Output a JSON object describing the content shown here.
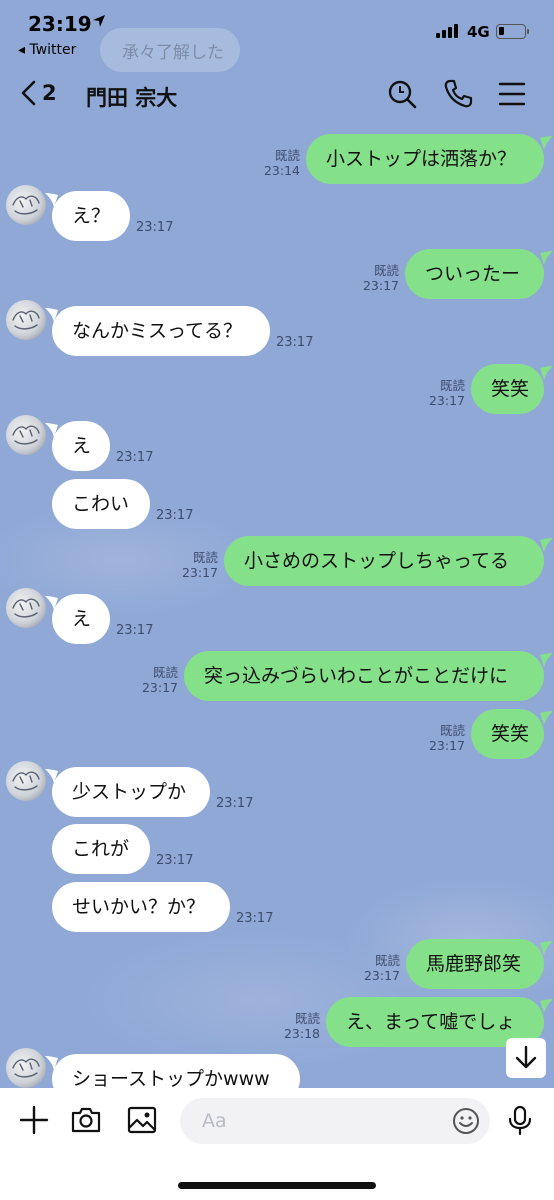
{
  "status_bar": {
    "time": "23:19",
    "back_app": "◂ Twitter",
    "network": "4G"
  },
  "ghost_text": "承々了解した",
  "header": {
    "back_count": "2",
    "chat_name": "門田 宗大",
    "icons": [
      "search-icon",
      "phone-icon",
      "menu-icon"
    ]
  },
  "messages": [
    {
      "side": "out",
      "text": "小ストップは洒落か？",
      "read": "既読",
      "time": "23:14"
    },
    {
      "side": "in",
      "text": "え？",
      "time": "23:17",
      "avatar": true
    },
    {
      "side": "out",
      "text": "ついったー",
      "read": "既読",
      "time": "23:17"
    },
    {
      "side": "in",
      "text": "なんかミスってる？",
      "time": "23:17",
      "avatar": true
    },
    {
      "side": "out",
      "text": "笑笑",
      "read": "既読",
      "time": "23:17"
    },
    {
      "side": "in",
      "text": "え",
      "time": "23:17",
      "avatar": true
    },
    {
      "side": "in",
      "text": "こわい",
      "time": "23:17",
      "avatar": false
    },
    {
      "side": "out",
      "text": "小さめのストップしちゃってる",
      "read": "既読",
      "time": "23:17"
    },
    {
      "side": "in",
      "text": "え",
      "time": "23:17",
      "avatar": true
    },
    {
      "side": "out",
      "text": "突っ込みづらいわことがことだけに",
      "read": "既読",
      "time": "23:17"
    },
    {
      "side": "out",
      "text": "笑笑",
      "read": "既読",
      "time": "23:17"
    },
    {
      "side": "in",
      "text": "少ストップか",
      "time": "23:17",
      "avatar": true
    },
    {
      "side": "in",
      "text": "これが",
      "time": "23:17",
      "avatar": false
    },
    {
      "side": "in",
      "text": "せいかい？か？",
      "time": "23:17",
      "avatar": false
    },
    {
      "side": "out",
      "text": "馬鹿野郎笑",
      "read": "既読",
      "time": "23:17"
    },
    {
      "side": "out",
      "text": "え、まって嘘でしょ",
      "read": "既読",
      "time": "23:18"
    },
    {
      "side": "in",
      "text": "ショーストップかwww",
      "time": "",
      "avatar": true
    }
  ],
  "input_bar": {
    "placeholder": "Aa",
    "icons": [
      "plus-icon",
      "camera-icon",
      "image-icon",
      "emoji-icon",
      "microphone-icon"
    ]
  },
  "colors": {
    "background": "#8fa8d6",
    "out_bubble": "#85e08a",
    "in_bubble": "#ffffff"
  }
}
